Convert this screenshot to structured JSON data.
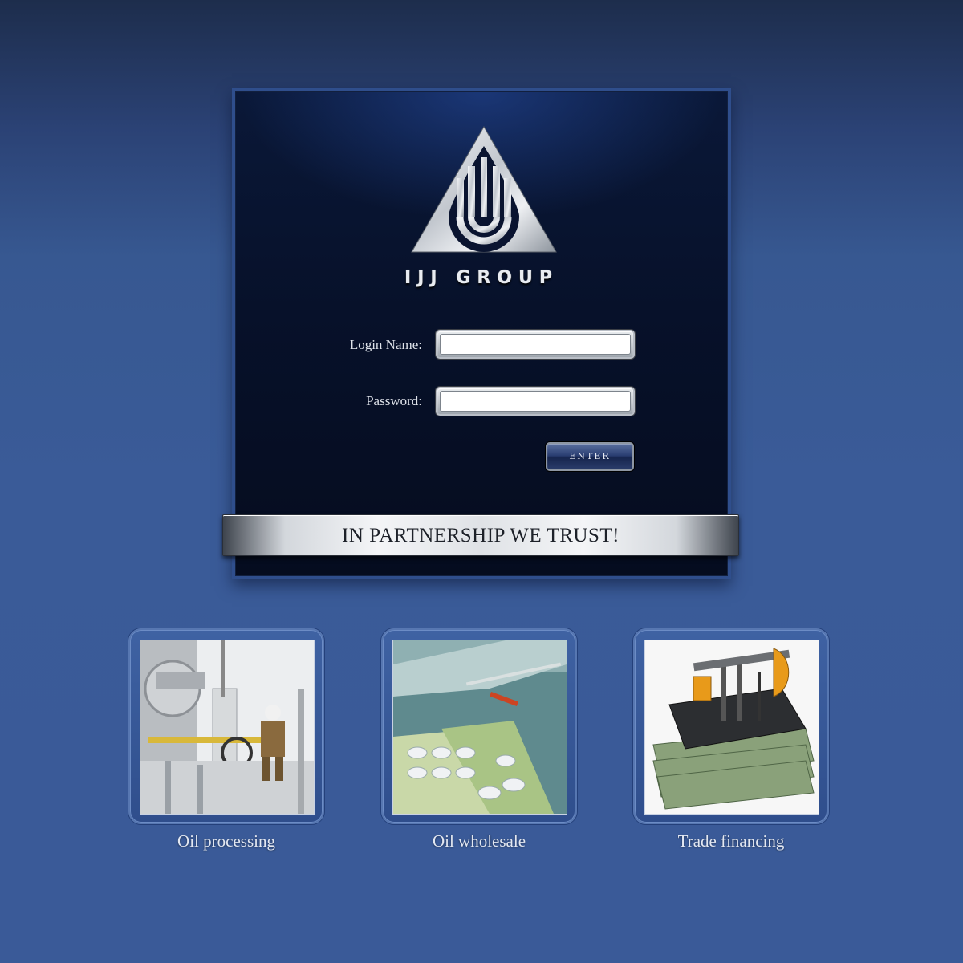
{
  "brand": {
    "logo_icon": "ijj-drop-triangle-logo",
    "name": "IJJ GROUP"
  },
  "login": {
    "username_label": "Login Name:",
    "username_value": "",
    "password_label": "Password:",
    "password_value": "",
    "submit_label": "ENTER"
  },
  "slogan": "IN PARTNERSHIP WE TRUST!",
  "services": [
    {
      "label": "Oil processing",
      "image": "refinery-worker-photo"
    },
    {
      "label": "Oil wholesale",
      "image": "oil-terminal-harbor-photo"
    },
    {
      "label": "Trade financing",
      "image": "pumpjack-on-money-photo"
    }
  ],
  "colors": {
    "background": "#3a5a98",
    "panel": "#07112a",
    "panel_border": "#2f4e8c",
    "text_light": "#dfe3ea"
  }
}
